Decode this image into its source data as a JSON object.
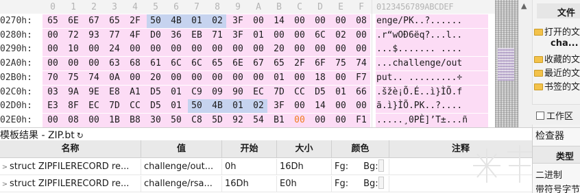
{
  "hex_editor": {
    "column_headers": [
      "0",
      "1",
      "2",
      "3",
      "4",
      "5",
      "6",
      "7",
      "8",
      "9",
      "A",
      "B",
      "C",
      "D",
      "E",
      "F"
    ],
    "ascii_header": "0123456789ABCDEF",
    "rows": [
      {
        "address": "0270h:",
        "bytes": [
          "65",
          "6E",
          "67",
          "65",
          "2F",
          "50",
          "4B",
          "01",
          "02",
          "3F",
          "00",
          "14",
          "00",
          "00",
          "00",
          "08"
        ],
        "ascii": "enge/PK..?......"
      },
      {
        "address": "0280h:",
        "bytes": [
          "00",
          "72",
          "93",
          "77",
          "4F",
          "D0",
          "36",
          "EB",
          "71",
          "3F",
          "01",
          "00",
          "00",
          "6C",
          "02",
          "00"
        ],
        "ascii": ".r“wOÐ6ëq?...l.."
      },
      {
        "address": "0290h:",
        "bytes": [
          "00",
          "10",
          "00",
          "24",
          "00",
          "00",
          "00",
          "00",
          "00",
          "00",
          "00",
          "20",
          "00",
          "00",
          "00",
          "00"
        ],
        "ascii": "...$....... ...."
      },
      {
        "address": "02A0h:",
        "bytes": [
          "00",
          "00",
          "00",
          "63",
          "68",
          "61",
          "6C",
          "6C",
          "65",
          "6E",
          "67",
          "65",
          "2F",
          "6F",
          "75",
          "74"
        ],
        "ascii": "...challenge/out"
      },
      {
        "address": "02B0h:",
        "bytes": [
          "70",
          "75",
          "74",
          "0A",
          "00",
          "20",
          "00",
          "00",
          "00",
          "00",
          "00",
          "01",
          "00",
          "18",
          "00",
          "F7"
        ],
        "ascii": "put.. .........÷"
      },
      {
        "address": "02C0h:",
        "bytes": [
          "03",
          "9A",
          "9E",
          "E8",
          "A1",
          "D5",
          "01",
          "C9",
          "09",
          "90",
          "EC",
          "7D",
          "CC",
          "D5",
          "01",
          "66"
        ],
        "ascii": ".šžè¡Õ.É..ì}ÌÕ.f"
      },
      {
        "address": "02D0h:",
        "bytes": [
          "E3",
          "8F",
          "EC",
          "7D",
          "CC",
          "D5",
          "01",
          "50",
          "4B",
          "01",
          "02",
          "3F",
          "00",
          "14",
          "00",
          "00"
        ],
        "ascii": "ã.ì}ÌÕ.PK..?...."
      },
      {
        "address": "02E0h:",
        "bytes": [
          "00",
          "08",
          "00",
          "1B",
          "B8",
          "30",
          "50",
          "C8",
          "5D",
          "92",
          "54",
          "B1",
          "00",
          "00",
          "00",
          "F1"
        ],
        "ascii": ".....¸0PÈ]’T±...ñ"
      }
    ]
  },
  "side_panel": {
    "title": "文件",
    "items": [
      {
        "label": "打开的文",
        "icon": "folder-icon"
      },
      {
        "label": "cha...",
        "icon": ""
      },
      {
        "label": "收藏的文",
        "icon": "folder-icon"
      },
      {
        "label": "最近的文",
        "icon": "folder-icon"
      },
      {
        "label": "书签的文",
        "icon": "folder-icon"
      }
    ],
    "work_area": "工作区"
  },
  "template_results": {
    "title": "模板结果 - ZIP.bt",
    "refresh_glyph": "↻",
    "columns": [
      "名称",
      "值",
      "开始",
      "大小",
      "颜色",
      "注释"
    ],
    "rows": [
      {
        "name": "struct ZIPFILERECORD re...",
        "value": "challenge/out...",
        "start": "0h",
        "size": "16Dh",
        "fg": "Fg:",
        "bg": "Bg:",
        "comment": ""
      },
      {
        "name": "struct ZIPFILERECORD re...",
        "value": "challenge/rsa...",
        "start": "16Dh",
        "size": "E0h",
        "fg": "Fg:",
        "bg": "Bg:",
        "comment": ""
      }
    ]
  },
  "inspector": {
    "title": "检查器",
    "column": "类型",
    "rows": [
      "二进制",
      "带符号字节"
    ]
  },
  "colors": {
    "hex_bg": "#fcdcf5",
    "highlight": "#c6d3ef",
    "selected_byte": "#f07b1f"
  }
}
